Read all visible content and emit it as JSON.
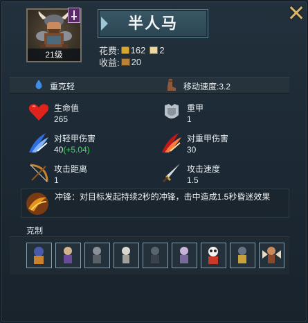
{
  "unit": {
    "name": "半人马",
    "level_label": "21级",
    "portrait_icon": "centaur-portrait",
    "rank_badge_icon": "sword-shield-badge"
  },
  "cost": {
    "label": "花费:",
    "gold": "162",
    "supply": "2"
  },
  "income": {
    "label": "收益:",
    "value": "20"
  },
  "traits": {
    "armor_class": "重克轻",
    "move_speed": "移动速度:3.2"
  },
  "stats": {
    "hp": {
      "label": "生命值",
      "value": "265"
    },
    "armor": {
      "label": "重甲",
      "value": "1"
    },
    "light_dmg": {
      "label": "对轻甲伤害",
      "value": "40",
      "bonus": "(+5.04)"
    },
    "heavy_dmg": {
      "label": "对重甲伤害",
      "value": "30"
    },
    "range": {
      "label": "攻击距离",
      "value": "1"
    },
    "atk_speed": {
      "label": "攻击速度",
      "value": "1.5"
    }
  },
  "skill": {
    "text": "冲锋：对目标发起持续2秒的冲锋，击中造成1.5秒昏迷效果"
  },
  "counters": {
    "label": "克制",
    "units": [
      "unit-1",
      "unit-2",
      "unit-3",
      "unit-4",
      "unit-5",
      "unit-6",
      "unit-7",
      "unit-8",
      "unit-9"
    ]
  },
  "colors": {
    "bonus": "#3ee05a",
    "close": "#d9b36a",
    "nameplate": "#3a5866"
  }
}
